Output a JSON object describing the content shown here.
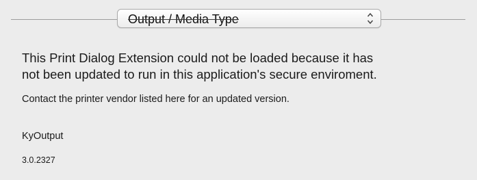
{
  "popup": {
    "selected": "Output / Media Type"
  },
  "message": {
    "line1": "This Print Dialog Extension could not be loaded because it has",
    "line2": "not been updated to run in this application's secure enviroment."
  },
  "contact_text": "Contact the printer vendor listed here for an updated version.",
  "extension": {
    "name": "KyOutput",
    "version": "3.0.2327"
  },
  "icons": {
    "popup_arrows": "up-down-chevron-icon"
  }
}
